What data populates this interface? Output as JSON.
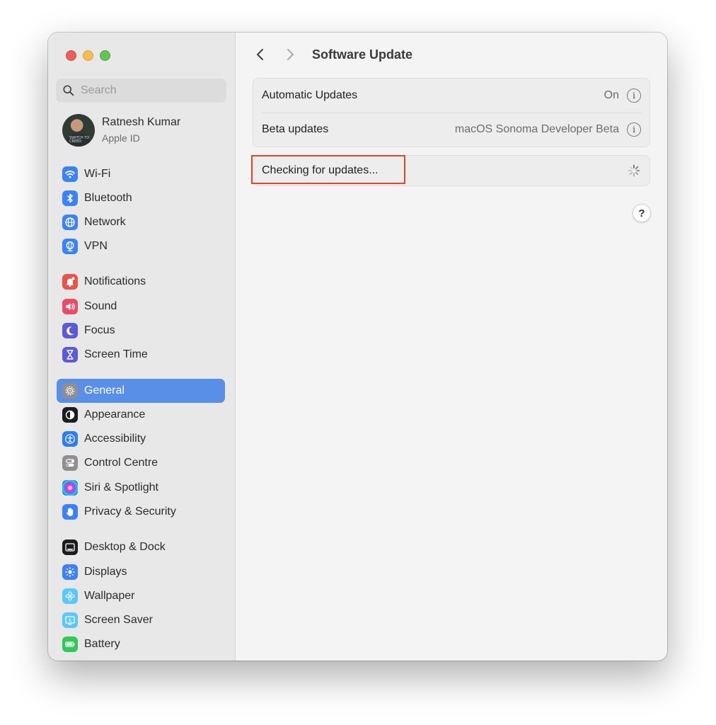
{
  "sidebar": {
    "search": {
      "placeholder": "Search"
    },
    "account": {
      "name": "Ratnesh Kumar",
      "subtitle": "Apple ID",
      "avatar_text": "SWITCH TO CREED"
    },
    "items": [
      {
        "label": "Wi-Fi",
        "icon": "wifi-icon",
        "color": "#3b82f6"
      },
      {
        "label": "Bluetooth",
        "icon": "bluetooth-icon",
        "color": "#3b82f6"
      },
      {
        "label": "Network",
        "icon": "globe-icon",
        "color": "#3b82f6"
      },
      {
        "label": "VPN",
        "icon": "vpn-globe-icon",
        "color": "#3b82f6"
      },
      {
        "label": "Notifications",
        "icon": "bell-icon",
        "color": "#e8534a"
      },
      {
        "label": "Sound",
        "icon": "speaker-icon",
        "color": "#e84c6a"
      },
      {
        "label": "Focus",
        "icon": "moon-icon",
        "color": "#5b5bd6"
      },
      {
        "label": "Screen Time",
        "icon": "hourglass-icon",
        "color": "#5b5bd6"
      },
      {
        "label": "General",
        "icon": "gear-icon",
        "color": "#8e8e93",
        "active": true
      },
      {
        "label": "Appearance",
        "icon": "appearance-icon",
        "color": "#1c1c1e"
      },
      {
        "label": "Accessibility",
        "icon": "accessibility-icon",
        "color": "#2f7cf6"
      },
      {
        "label": "Control Centre",
        "icon": "toggles-icon",
        "color": "#8e8e93"
      },
      {
        "label": "Siri & Spotlight",
        "icon": "siri-icon",
        "color": "#222244"
      },
      {
        "label": "Privacy & Security",
        "icon": "hand-icon",
        "color": "#3b82f6"
      },
      {
        "label": "Desktop & Dock",
        "icon": "dock-icon",
        "color": "#1c1c1e"
      },
      {
        "label": "Displays",
        "icon": "sun-icon",
        "color": "#3b82f6"
      },
      {
        "label": "Wallpaper",
        "icon": "flower-icon",
        "color": "#5ac8fa"
      },
      {
        "label": "Screen Saver",
        "icon": "screensaver-icon",
        "color": "#5ac8fa"
      },
      {
        "label": "Battery",
        "icon": "battery-icon",
        "color": "#34c759"
      }
    ]
  },
  "main": {
    "title": "Software Update",
    "settings": [
      {
        "label": "Automatic Updates",
        "value": "On"
      },
      {
        "label": "Beta updates",
        "value": "macOS Sonoma Developer Beta"
      }
    ],
    "status": "Checking for updates...",
    "help": "?",
    "info_glyph": "i",
    "highlight_color": "#e2462b"
  }
}
